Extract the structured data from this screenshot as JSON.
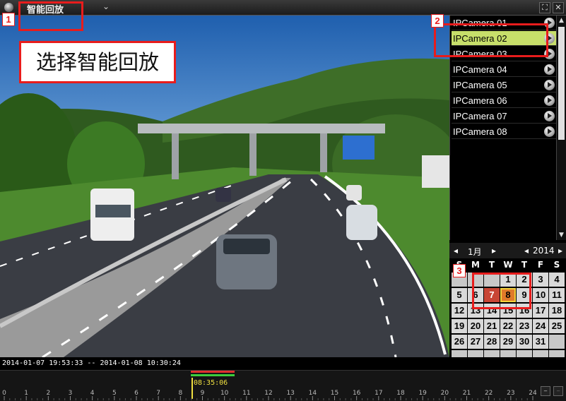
{
  "window": {
    "title": "智能回放",
    "dropdown_icon": "chevron-down-icon",
    "controls": {
      "restore": "⛶",
      "close": "✕"
    }
  },
  "cameras": [
    {
      "label": "IPCamera 01"
    },
    {
      "label": "IPCamera 02",
      "selected": true
    },
    {
      "label": "IPCamera 03"
    },
    {
      "label": "IPCamera 04"
    },
    {
      "label": "IPCamera 05"
    },
    {
      "label": "IPCamera 06"
    },
    {
      "label": "IPCamera 07"
    },
    {
      "label": "IPCamera 08"
    }
  ],
  "calendar": {
    "month": "1月",
    "year": "2014",
    "prev": "◂",
    "next": "▸",
    "weekdays": [
      "S",
      "M",
      "T",
      "W",
      "T",
      "F",
      "S"
    ],
    "rows": [
      [
        "",
        "",
        "",
        "1",
        "2",
        "3",
        "4"
      ],
      [
        "5",
        "6",
        "7",
        "8",
        "9",
        "10",
        "11"
      ],
      [
        "12",
        "13",
        "14",
        "15",
        "16",
        "17",
        "18"
      ],
      [
        "19",
        "20",
        "21",
        "22",
        "23",
        "24",
        "25"
      ],
      [
        "26",
        "27",
        "28",
        "29",
        "30",
        "31",
        ""
      ],
      [
        "",
        "",
        "",
        "",
        "",
        "",
        ""
      ]
    ],
    "recorded_days": [
      "7"
    ],
    "current_day": "8"
  },
  "playback": {
    "range": "2014-01-07 19:53:33 -- 2014-01-08 10:30:24",
    "cursor_time": "08:35:06",
    "hours": [
      "0",
      "1",
      "2",
      "3",
      "4",
      "5",
      "6",
      "7",
      "8",
      "9",
      "10",
      "11",
      "12",
      "13",
      "14",
      "15",
      "16",
      "17",
      "18",
      "19",
      "20",
      "21",
      "22",
      "23",
      "24"
    ]
  },
  "annotations": {
    "callout_text": "选择智能回放",
    "step1": "1",
    "step2": "2",
    "step3": "3"
  },
  "colors": {
    "annotation_red": "#e81c1c",
    "selected_camera": "#c7df6a",
    "recorded_day": "#c84535",
    "current_day": "#e07a2a"
  }
}
